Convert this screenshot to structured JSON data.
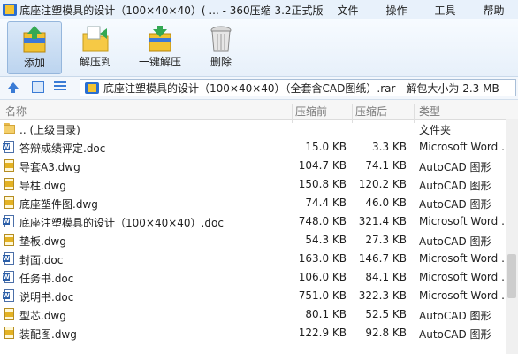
{
  "window": {
    "title": "底座注塑模具的设计（100×40×40）( ... - 360压缩 3.2正式版",
    "menu": [
      "文件",
      "操作",
      "工具",
      "帮助"
    ]
  },
  "toolbar": {
    "add_label": "添加",
    "extract_to_label": "解压到",
    "one_click_extract_label": "一键解压",
    "delete_label": "删除"
  },
  "address": {
    "path_text": "底座注塑模具的设计（100×40×40）（全套含CAD图纸）.rar - 解包大小为 2.3 MB"
  },
  "columns": {
    "name": "名称",
    "size": "压缩前",
    "packed": "压缩后",
    "type": "类型"
  },
  "files": [
    {
      "name": ".. (上级目录)",
      "size": "",
      "packed": "",
      "type": "文件夹",
      "icon": "folder-icon"
    },
    {
      "name": "答辩成绩评定.doc",
      "size": "15.0 KB",
      "packed": "3.3 KB",
      "type": "Microsoft Word ...",
      "icon": "word-doc-icon"
    },
    {
      "name": "导套A3.dwg",
      "size": "104.7 KB",
      "packed": "74.1 KB",
      "type": "AutoCAD 图形",
      "icon": "autocad-dwg-icon"
    },
    {
      "name": "导柱.dwg",
      "size": "150.8 KB",
      "packed": "120.2 KB",
      "type": "AutoCAD 图形",
      "icon": "autocad-dwg-icon"
    },
    {
      "name": "底座塑件图.dwg",
      "size": "74.4 KB",
      "packed": "46.0 KB",
      "type": "AutoCAD 图形",
      "icon": "autocad-dwg-icon"
    },
    {
      "name": "底座注塑模具的设计（100×40×40）.doc",
      "size": "748.0 KB",
      "packed": "321.4 KB",
      "type": "Microsoft Word ...",
      "icon": "word-doc-icon"
    },
    {
      "name": "垫板.dwg",
      "size": "54.3 KB",
      "packed": "27.3 KB",
      "type": "AutoCAD 图形",
      "icon": "autocad-dwg-icon"
    },
    {
      "name": "封面.doc",
      "size": "163.0 KB",
      "packed": "146.7 KB",
      "type": "Microsoft Word ...",
      "icon": "word-doc-icon"
    },
    {
      "name": "任务书.doc",
      "size": "106.0 KB",
      "packed": "84.1 KB",
      "type": "Microsoft Word ...",
      "icon": "word-doc-icon"
    },
    {
      "name": "说明书.doc",
      "size": "751.0 KB",
      "packed": "322.3 KB",
      "type": "Microsoft Word ...",
      "icon": "word-doc-icon"
    },
    {
      "name": "型芯.dwg",
      "size": "80.1 KB",
      "packed": "52.5 KB",
      "type": "AutoCAD 图形",
      "icon": "autocad-dwg-icon"
    },
    {
      "name": "装配图.dwg",
      "size": "122.9 KB",
      "packed": "92.8 KB",
      "type": "AutoCAD 图形",
      "icon": "autocad-dwg-icon"
    }
  ]
}
